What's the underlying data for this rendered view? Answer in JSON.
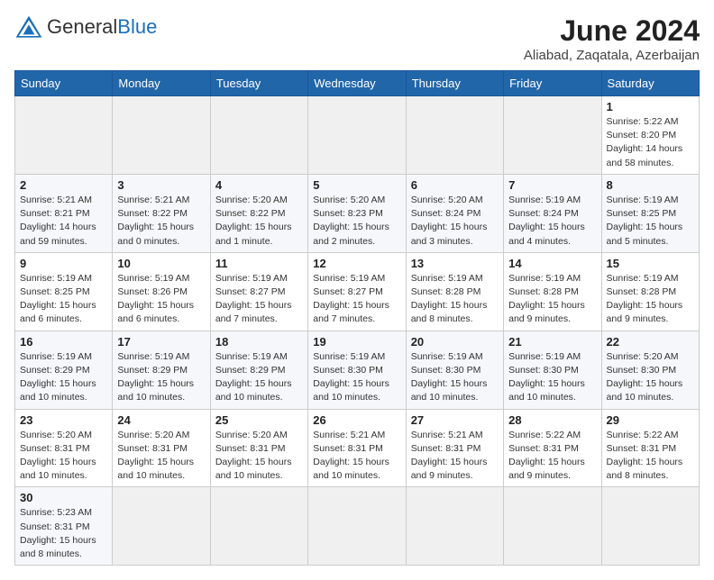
{
  "header": {
    "logo_general": "General",
    "logo_blue": "Blue",
    "month_year": "June 2024",
    "location": "Aliabad, Zaqatala, Azerbaijan"
  },
  "weekdays": [
    "Sunday",
    "Monday",
    "Tuesday",
    "Wednesday",
    "Thursday",
    "Friday",
    "Saturday"
  ],
  "weeks": [
    [
      {
        "day": "",
        "info": ""
      },
      {
        "day": "",
        "info": ""
      },
      {
        "day": "",
        "info": ""
      },
      {
        "day": "",
        "info": ""
      },
      {
        "day": "",
        "info": ""
      },
      {
        "day": "",
        "info": ""
      },
      {
        "day": "1",
        "info": "Sunrise: 5:22 AM\nSunset: 8:20 PM\nDaylight: 14 hours\nand 58 minutes."
      }
    ],
    [
      {
        "day": "2",
        "info": "Sunrise: 5:21 AM\nSunset: 8:21 PM\nDaylight: 14 hours\nand 59 minutes."
      },
      {
        "day": "3",
        "info": "Sunrise: 5:21 AM\nSunset: 8:22 PM\nDaylight: 15 hours\nand 0 minutes."
      },
      {
        "day": "4",
        "info": "Sunrise: 5:20 AM\nSunset: 8:22 PM\nDaylight: 15 hours\nand 1 minute."
      },
      {
        "day": "5",
        "info": "Sunrise: 5:20 AM\nSunset: 8:23 PM\nDaylight: 15 hours\nand 2 minutes."
      },
      {
        "day": "6",
        "info": "Sunrise: 5:20 AM\nSunset: 8:24 PM\nDaylight: 15 hours\nand 3 minutes."
      },
      {
        "day": "7",
        "info": "Sunrise: 5:19 AM\nSunset: 8:24 PM\nDaylight: 15 hours\nand 4 minutes."
      },
      {
        "day": "8",
        "info": "Sunrise: 5:19 AM\nSunset: 8:25 PM\nDaylight: 15 hours\nand 5 minutes."
      }
    ],
    [
      {
        "day": "9",
        "info": "Sunrise: 5:19 AM\nSunset: 8:25 PM\nDaylight: 15 hours\nand 6 minutes."
      },
      {
        "day": "10",
        "info": "Sunrise: 5:19 AM\nSunset: 8:26 PM\nDaylight: 15 hours\nand 6 minutes."
      },
      {
        "day": "11",
        "info": "Sunrise: 5:19 AM\nSunset: 8:27 PM\nDaylight: 15 hours\nand 7 minutes."
      },
      {
        "day": "12",
        "info": "Sunrise: 5:19 AM\nSunset: 8:27 PM\nDaylight: 15 hours\nand 7 minutes."
      },
      {
        "day": "13",
        "info": "Sunrise: 5:19 AM\nSunset: 8:28 PM\nDaylight: 15 hours\nand 8 minutes."
      },
      {
        "day": "14",
        "info": "Sunrise: 5:19 AM\nSunset: 8:28 PM\nDaylight: 15 hours\nand 9 minutes."
      },
      {
        "day": "15",
        "info": "Sunrise: 5:19 AM\nSunset: 8:28 PM\nDaylight: 15 hours\nand 9 minutes."
      }
    ],
    [
      {
        "day": "16",
        "info": "Sunrise: 5:19 AM\nSunset: 8:29 PM\nDaylight: 15 hours\nand 10 minutes."
      },
      {
        "day": "17",
        "info": "Sunrise: 5:19 AM\nSunset: 8:29 PM\nDaylight: 15 hours\nand 10 minutes."
      },
      {
        "day": "18",
        "info": "Sunrise: 5:19 AM\nSunset: 8:29 PM\nDaylight: 15 hours\nand 10 minutes."
      },
      {
        "day": "19",
        "info": "Sunrise: 5:19 AM\nSunset: 8:30 PM\nDaylight: 15 hours\nand 10 minutes."
      },
      {
        "day": "20",
        "info": "Sunrise: 5:19 AM\nSunset: 8:30 PM\nDaylight: 15 hours\nand 10 minutes."
      },
      {
        "day": "21",
        "info": "Sunrise: 5:19 AM\nSunset: 8:30 PM\nDaylight: 15 hours\nand 10 minutes."
      },
      {
        "day": "22",
        "info": "Sunrise: 5:20 AM\nSunset: 8:30 PM\nDaylight: 15 hours\nand 10 minutes."
      }
    ],
    [
      {
        "day": "23",
        "info": "Sunrise: 5:20 AM\nSunset: 8:31 PM\nDaylight: 15 hours\nand 10 minutes."
      },
      {
        "day": "24",
        "info": "Sunrise: 5:20 AM\nSunset: 8:31 PM\nDaylight: 15 hours\nand 10 minutes."
      },
      {
        "day": "25",
        "info": "Sunrise: 5:20 AM\nSunset: 8:31 PM\nDaylight: 15 hours\nand 10 minutes."
      },
      {
        "day": "26",
        "info": "Sunrise: 5:21 AM\nSunset: 8:31 PM\nDaylight: 15 hours\nand 10 minutes."
      },
      {
        "day": "27",
        "info": "Sunrise: 5:21 AM\nSunset: 8:31 PM\nDaylight: 15 hours\nand 9 minutes."
      },
      {
        "day": "28",
        "info": "Sunrise: 5:22 AM\nSunset: 8:31 PM\nDaylight: 15 hours\nand 9 minutes."
      },
      {
        "day": "29",
        "info": "Sunrise: 5:22 AM\nSunset: 8:31 PM\nDaylight: 15 hours\nand 8 minutes."
      }
    ],
    [
      {
        "day": "30",
        "info": "Sunrise: 5:23 AM\nSunset: 8:31 PM\nDaylight: 15 hours\nand 8 minutes."
      },
      {
        "day": "",
        "info": ""
      },
      {
        "day": "",
        "info": ""
      },
      {
        "day": "",
        "info": ""
      },
      {
        "day": "",
        "info": ""
      },
      {
        "day": "",
        "info": ""
      },
      {
        "day": "",
        "info": ""
      }
    ]
  ]
}
